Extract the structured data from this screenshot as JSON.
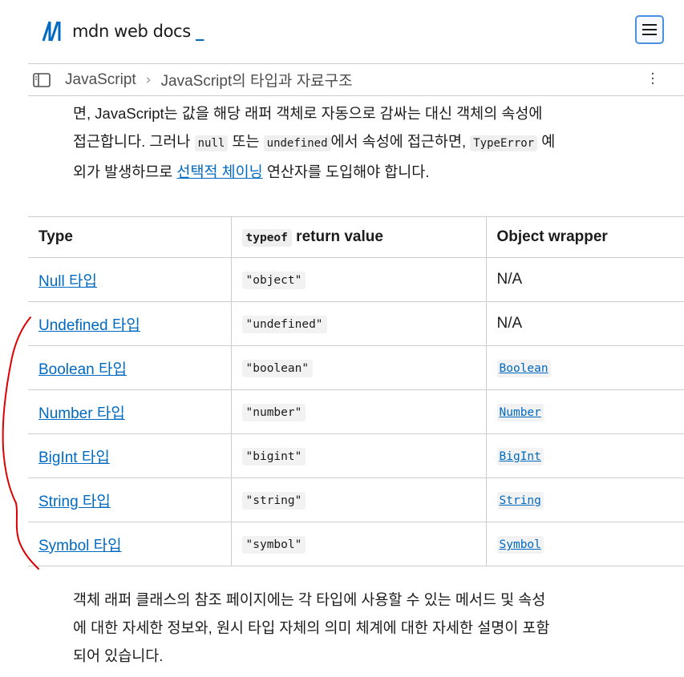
{
  "header": {
    "logo_text": "mdn web docs",
    "logo_cursor": "_",
    "menu_icon": "hamburger-menu-icon"
  },
  "breadcrumb": {
    "items": [
      "JavaScript",
      "JavaScript의 타입과 자료구조"
    ],
    "separator": "›",
    "more_icon": "kebab-menu-icon"
  },
  "intro": {
    "t1": "면, JavaScript는 값을 해당 래퍼 객체로 자동으로 감싸는 대신 객체의 속성에",
    "t2": "접근합니다. 그러나 ",
    "code_null": "null",
    "t3": " 또는 ",
    "code_undefined": "undefined",
    "t4": "에서 속성에 접근하면, ",
    "code_typeerror": "TypeError",
    "t5": " 예",
    "t6": "외가 발생하므로 ",
    "link": "선택적 체이닝",
    "t7": " 연산자를 도입해야 합니다."
  },
  "table": {
    "headers": {
      "type": "Type",
      "typeof_code": "typeof",
      "typeof_rest": " return value",
      "wrapper": "Object wrapper"
    },
    "rows": [
      {
        "type": "Null 타입",
        "typeof": "\"object\"",
        "wrapper": "N/A",
        "wrapper_is_link": false
      },
      {
        "type": "Undefined 타입",
        "typeof": "\"undefined\"",
        "wrapper": "N/A",
        "wrapper_is_link": false
      },
      {
        "type": "Boolean 타입",
        "typeof": "\"boolean\"",
        "wrapper": "Boolean",
        "wrapper_is_link": true
      },
      {
        "type": "Number 타입",
        "typeof": "\"number\"",
        "wrapper": "Number",
        "wrapper_is_link": true
      },
      {
        "type": "BigInt 타입",
        "typeof": "\"bigint\"",
        "wrapper": "BigInt",
        "wrapper_is_link": true
      },
      {
        "type": "String 타입",
        "typeof": "\"string\"",
        "wrapper": "String",
        "wrapper_is_link": true
      },
      {
        "type": "Symbol 타입",
        "typeof": "\"symbol\"",
        "wrapper": "Symbol",
        "wrapper_is_link": true
      }
    ]
  },
  "outro": {
    "l1": "객체 래퍼 클래스의 참조 페이지에는 각 타입에 사용할 수 있는 메서드 및 속성",
    "l2": "에 대한 자세한 정보와, 원시 타입 자체의 의미 체계에 대한 자세한 설명이 포함",
    "l3": "되어 있습니다."
  },
  "colors": {
    "link": "#0069c2",
    "border": "#cdcdcd",
    "annotation": "#e00000"
  }
}
